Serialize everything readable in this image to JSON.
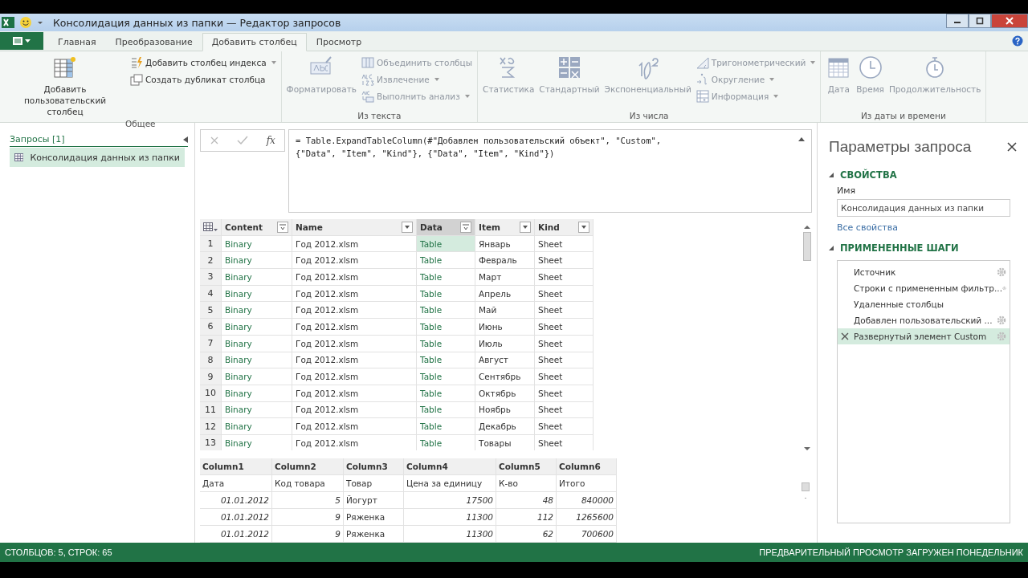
{
  "window": {
    "title": "Консолидация данных из папки — Редактор запросов"
  },
  "tabs": [
    {
      "label": "Главная",
      "selected": false
    },
    {
      "label": "Преобразование",
      "selected": false
    },
    {
      "label": "Добавить столбец",
      "selected": true
    },
    {
      "label": "Просмотр",
      "selected": false
    }
  ],
  "ribbon": [
    {
      "label": "Общее",
      "items": [
        {
          "kind": "large",
          "label": "Добавить пользовательский столбец",
          "disabled": false
        },
        {
          "kind": "stack",
          "entries": [
            {
              "label": "Добавить столбец индекса",
              "dropdown": true,
              "disabled": false
            },
            {
              "label": "Создать дубликат столбца",
              "dropdown": false,
              "disabled": false
            }
          ]
        }
      ]
    },
    {
      "label": "Из текста",
      "items": [
        {
          "kind": "large",
          "label": "Форматировать",
          "disabled": true
        },
        {
          "kind": "stack",
          "entries": [
            {
              "label": "Объединить столбцы",
              "dropdown": false,
              "disabled": true
            },
            {
              "label": "Извлечение",
              "dropdown": true,
              "disabled": true
            },
            {
              "label": "Выполнить анализ",
              "dropdown": true,
              "disabled": true
            }
          ]
        }
      ]
    },
    {
      "label": "Из числа",
      "items": [
        {
          "kind": "large",
          "label": "Статистика",
          "disabled": true
        },
        {
          "kind": "large",
          "label": "Стандартный",
          "disabled": true
        },
        {
          "kind": "large",
          "label": "Экспоненциальный",
          "disabled": true
        },
        {
          "kind": "stack",
          "entries": [
            {
              "label": "Тригонометрический",
              "dropdown": true,
              "disabled": true
            },
            {
              "label": "Округление",
              "dropdown": true,
              "disabled": true
            },
            {
              "label": "Информация",
              "dropdown": true,
              "disabled": true
            }
          ]
        }
      ]
    },
    {
      "label": "Из даты и времени",
      "items": [
        {
          "kind": "large",
          "label": "Дата",
          "disabled": true
        },
        {
          "kind": "large",
          "label": "Время",
          "disabled": true
        },
        {
          "kind": "large",
          "label": "Продолжительность",
          "disabled": true
        }
      ]
    }
  ],
  "queries": {
    "title": "Запросы [1]",
    "items": [
      {
        "label": "Консолидация данных из папки",
        "selected": true
      }
    ]
  },
  "fx": "fx",
  "formula": "= Table.ExpandTableColumn(#\"Добавлен пользовательский объект\", \"Custom\",\n{\"Data\", \"Item\", \"Kind\"}, {\"Data\", \"Item\", \"Kind\"})",
  "table": {
    "columns": [
      {
        "label": "Content",
        "selected": false
      },
      {
        "label": "Name",
        "selected": false
      },
      {
        "label": "Data",
        "selected": true
      },
      {
        "label": "Item",
        "selected": false
      },
      {
        "label": "Kind",
        "selected": false
      }
    ],
    "rows": [
      {
        "number": "1",
        "cells": [
          "Binary",
          "Год 2012.xlsm",
          "Table",
          "Январь",
          "Sheet"
        ]
      },
      {
        "number": "2",
        "cells": [
          "Binary",
          "Год 2012.xlsm",
          "Table",
          "Февраль",
          "Sheet"
        ]
      },
      {
        "number": "3",
        "cells": [
          "Binary",
          "Год 2012.xlsm",
          "Table",
          "Март",
          "Sheet"
        ]
      },
      {
        "number": "4",
        "cells": [
          "Binary",
          "Год 2012.xlsm",
          "Table",
          "Апрель",
          "Sheet"
        ]
      },
      {
        "number": "5",
        "cells": [
          "Binary",
          "Год 2012.xlsm",
          "Table",
          "Май",
          "Sheet"
        ]
      },
      {
        "number": "6",
        "cells": [
          "Binary",
          "Год 2012.xlsm",
          "Table",
          "Июнь",
          "Sheet"
        ]
      },
      {
        "number": "7",
        "cells": [
          "Binary",
          "Год 2012.xlsm",
          "Table",
          "Июль",
          "Sheet"
        ]
      },
      {
        "number": "8",
        "cells": [
          "Binary",
          "Год 2012.xlsm",
          "Table",
          "Август",
          "Sheet"
        ]
      },
      {
        "number": "9",
        "cells": [
          "Binary",
          "Год 2012.xlsm",
          "Table",
          "Сентябрь",
          "Sheet"
        ]
      },
      {
        "number": "10",
        "cells": [
          "Binary",
          "Год 2012.xlsm",
          "Table",
          "Октябрь",
          "Sheet"
        ]
      },
      {
        "number": "11",
        "cells": [
          "Binary",
          "Год 2012.xlsm",
          "Table",
          "Ноябрь",
          "Sheet"
        ]
      },
      {
        "number": "12",
        "cells": [
          "Binary",
          "Год 2012.xlsm",
          "Table",
          "Декабрь",
          "Sheet"
        ]
      },
      {
        "number": "13",
        "cells": [
          "Binary",
          "Год 2012.xlsm",
          "Table",
          "Товары",
          "Sheet"
        ]
      }
    ]
  },
  "preview": {
    "columns": [
      "Column1",
      "Column2",
      "Column3",
      "Column4",
      "Column5",
      "Column6"
    ],
    "rows": [
      [
        "Дата",
        "Код товара",
        "Товар",
        "Цена за единицу",
        "К-во",
        "Итого"
      ],
      [
        "01.01.2012",
        "5",
        "Йогурт",
        "17500",
        "48",
        "840000"
      ],
      [
        "01.01.2012",
        "9",
        "Ряженка",
        "11300",
        "112",
        "1265600"
      ],
      [
        "01.01.2012",
        "9",
        "Ряженка",
        "11300",
        "62",
        "700600"
      ]
    ]
  },
  "settings": {
    "title": "Параметры запроса",
    "properties_heading": "СВОЙСТВА",
    "name_label": "Имя",
    "name_value": "Консолидация данных из папки",
    "all_properties": "Все свойства",
    "steps_heading": "ПРИМЕНЕННЫЕ ШАГИ",
    "steps": [
      {
        "label": "Источник",
        "settings": true,
        "selected": false
      },
      {
        "label": "Строки с примененным фильтр...",
        "settings": true,
        "selected": false
      },
      {
        "label": "Удаленные столбцы",
        "settings": false,
        "selected": false
      },
      {
        "label": "Добавлен пользовательский ...",
        "settings": true,
        "selected": false
      },
      {
        "label": "Развернутый элемент Custom",
        "settings": true,
        "selected": true
      }
    ]
  },
  "status_bar": {
    "left": "СТОЛБЦОВ: 5, СТРОК: 65",
    "right": "ПРЕДВАРИТЕЛЬНЫЙ ПРОСМОТР ЗАГРУЖЕН ПОНЕДЕЛЬНИК"
  }
}
